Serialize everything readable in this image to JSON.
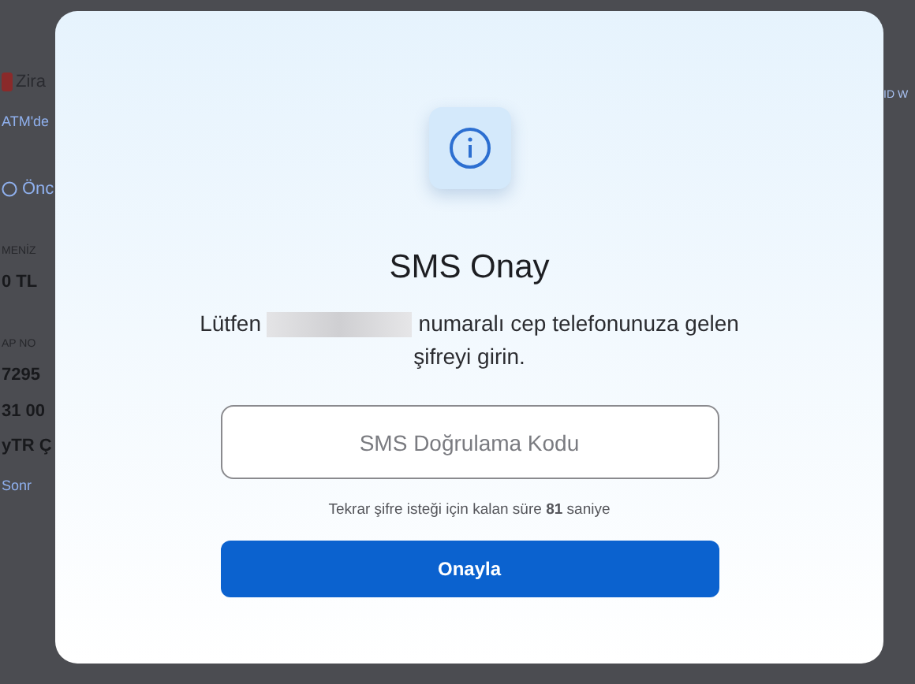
{
  "background": {
    "left_items": [
      {
        "kind": "brand",
        "text": "Zira"
      },
      {
        "kind": "link",
        "text": "ATM'de"
      },
      {
        "kind": "notice",
        "text": "Önc"
      },
      {
        "kind": "label",
        "text": "MENİZ"
      },
      {
        "kind": "value",
        "text": "0 TL"
      },
      {
        "kind": "label",
        "text": "AP NO"
      },
      {
        "kind": "value",
        "text": "7295"
      },
      {
        "kind": "value",
        "text": "31 00"
      },
      {
        "kind": "value",
        "text": "yTR Ç"
      },
      {
        "kind": "link",
        "text": "Sonr"
      }
    ],
    "right_items": [
      {
        "kind": "link",
        "text": "ID W"
      }
    ]
  },
  "dialog": {
    "title": "SMS Onay",
    "message_before": "Lütfen",
    "message_after": "numaralı cep telefonunuza gelen şifreyi girin.",
    "redacted": true,
    "code_field": {
      "placeholder": "SMS Doğrulama Kodu"
    },
    "countdown": "Tekrar şifre isteği için kalan süre **81** saniye",
    "confirm_button": "Onayla"
  }
}
